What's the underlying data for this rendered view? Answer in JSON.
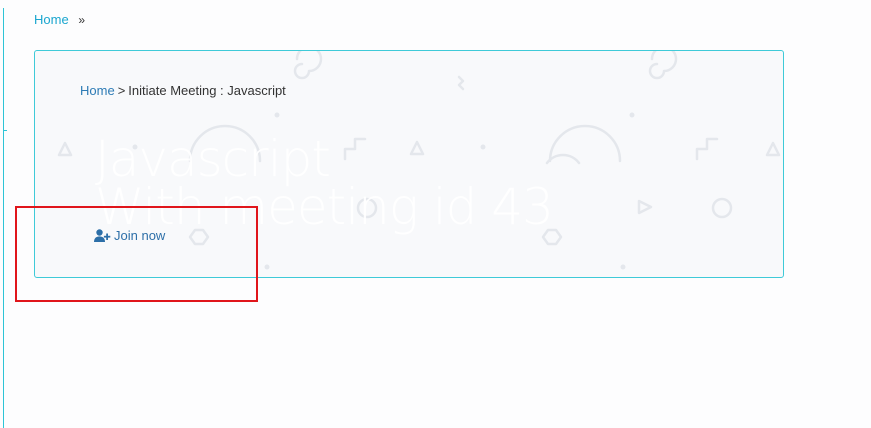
{
  "top_breadcrumb": {
    "home_label": "Home",
    "separator": "»"
  },
  "card": {
    "breadcrumb": {
      "home_label": "Home",
      "separator": ">",
      "current_label": "Initiate Meeting : Javascript"
    },
    "title_line1": "Javascript",
    "title_line2": "With meeting id 43",
    "join_label": "Join now",
    "join_icon": "user-plus-icon"
  },
  "colors": {
    "accent_cyan": "#3fcad8",
    "link_blue": "#1aa6cf",
    "link_dark_blue": "#2d7bb5",
    "highlight_red": "#e0151b"
  }
}
